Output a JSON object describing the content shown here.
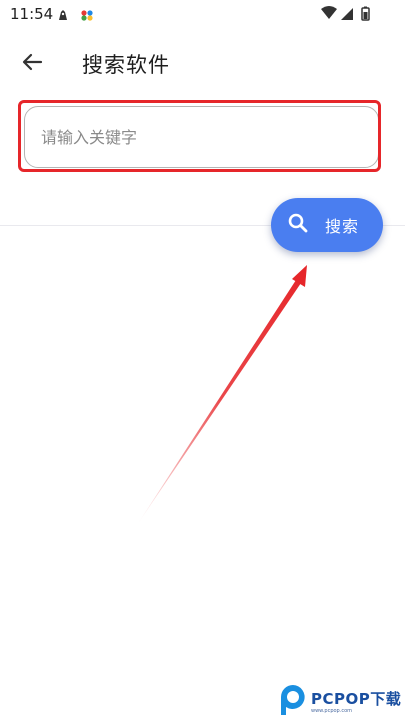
{
  "status_bar": {
    "time": "11:54",
    "icons": [
      "robot-icon",
      "bird-icon",
      "wifi-icon",
      "signal-icon",
      "battery-icon"
    ]
  },
  "app_bar": {
    "title": "搜索软件",
    "back_icon": "arrow-left-icon"
  },
  "search": {
    "placeholder": "请输入关键字",
    "value": ""
  },
  "fab": {
    "label": "搜索",
    "icon": "search-icon",
    "color": "#4a7ef0"
  },
  "annotation": {
    "color": "#e6262a"
  },
  "watermark": {
    "text": "PCPOP下载",
    "sub": "www.pcpop.com"
  }
}
